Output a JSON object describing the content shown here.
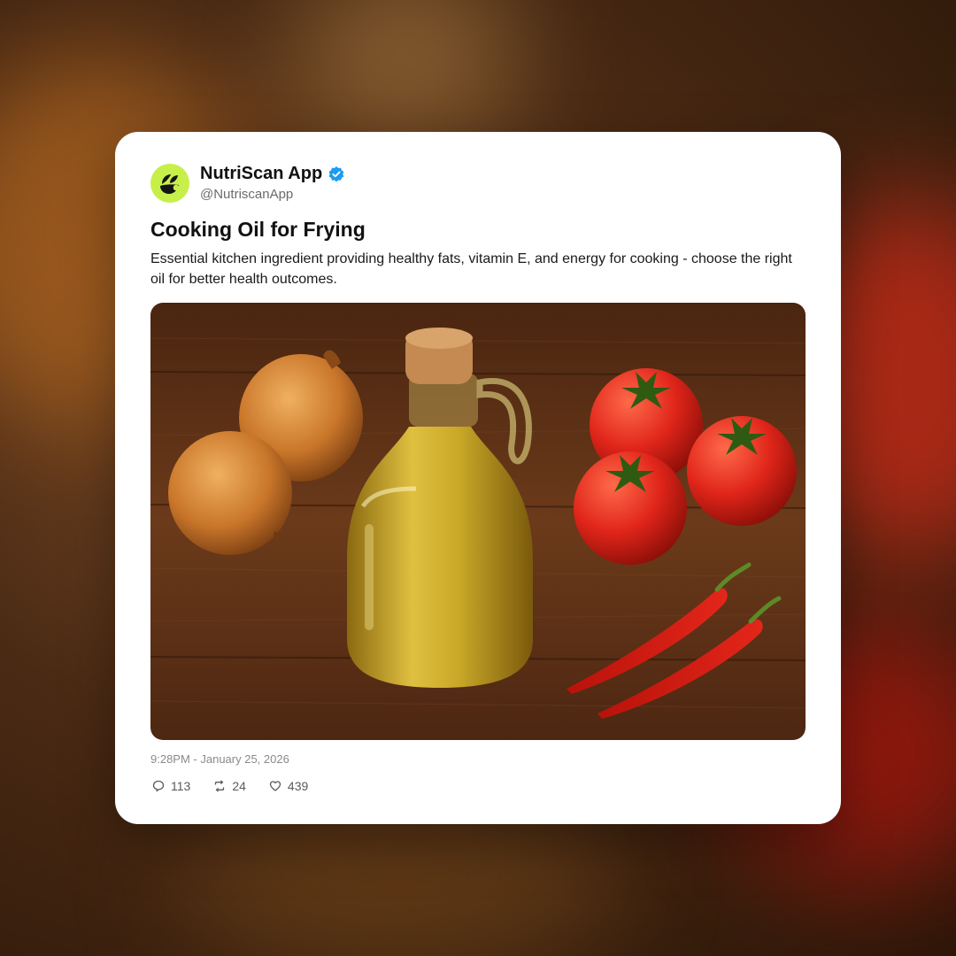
{
  "account": {
    "display_name": "NutriScan App",
    "handle": "@NutriscanApp",
    "verified": true,
    "avatar_icon": "nutriscan-logo-icon",
    "avatar_color": "#c6ef4a",
    "verified_color": "#1d9bf0"
  },
  "post": {
    "title": "Cooking Oil for Frying",
    "description": "Essential kitchen ingredient providing healthy fats, vitamin E, and energy for cooking - choose the right oil for better health outcomes.",
    "timestamp": "9:28PM - January 25, 2026",
    "image_subject": "oil-jug-onions-tomatoes-chillies-photo"
  },
  "stats": {
    "replies": "113",
    "reposts": "24",
    "likes": "439"
  }
}
